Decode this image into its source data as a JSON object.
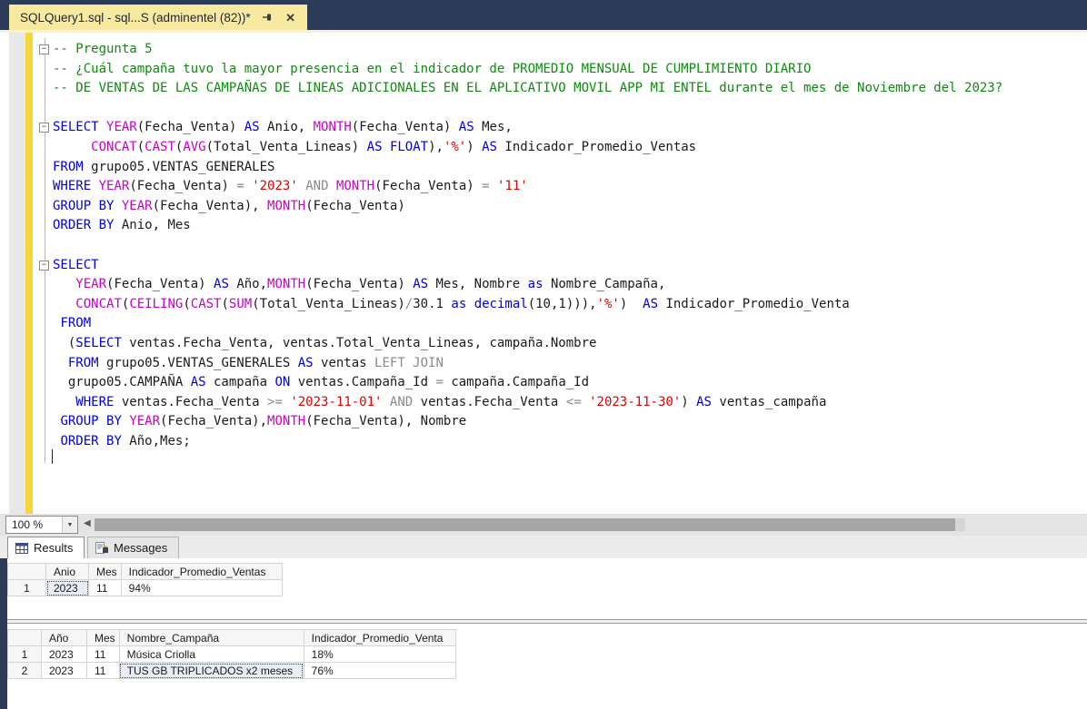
{
  "colors": {
    "window_chrome": "#2b3b58",
    "tab_active_bg": "#f7e9a0",
    "change_tracking_bar": "#f6d73b",
    "syntax_keyword": "#0000e0",
    "syntax_function": "#c800c8",
    "syntax_string": "#e00000",
    "syntax_comment": "#0f8a0f",
    "syntax_operator": "#8a8a8a"
  },
  "tab": {
    "title": "SQLQuery1.sql - sql...S (adminentel (82))*"
  },
  "editor": {
    "lines": [
      {
        "fold": true,
        "tokens": [
          [
            "c",
            "-- Pregunta 5"
          ]
        ]
      },
      {
        "tokens": [
          [
            "c",
            "-- ¿Cuál campaña tuvo la mayor presencia en el indicador de PROMEDIO MENSUAL DE CUMPLIMIENTO DIARIO"
          ]
        ]
      },
      {
        "tokens": [
          [
            "c",
            "-- DE VENTAS DE LAS CAMPAÑAS DE LINEAS ADICIONALES EN EL APLICATIVO MOVIL APP MI ENTEL durante el mes de Noviembre del 2023?"
          ]
        ]
      },
      {
        "tokens": []
      },
      {
        "fold": true,
        "tokens": [
          [
            "k",
            "SELECT "
          ],
          [
            "f",
            "YEAR"
          ],
          [
            "t",
            "(Fecha_Venta) "
          ],
          [
            "k",
            "AS"
          ],
          [
            "t",
            " Anio, "
          ],
          [
            "f",
            "MONTH"
          ],
          [
            "t",
            "(Fecha_Venta) "
          ],
          [
            "k",
            "AS"
          ],
          [
            "t",
            " Mes,"
          ]
        ]
      },
      {
        "tokens": [
          [
            "t",
            "     "
          ],
          [
            "f",
            "CONCAT"
          ],
          [
            "t",
            "("
          ],
          [
            "f",
            "CAST"
          ],
          [
            "t",
            "("
          ],
          [
            "f",
            "AVG"
          ],
          [
            "t",
            "(Total_Venta_Lineas) "
          ],
          [
            "k",
            "AS"
          ],
          [
            "t",
            " "
          ],
          [
            "k",
            "FLOAT"
          ],
          [
            "t",
            "),"
          ],
          [
            "s",
            "'%'"
          ],
          [
            "t",
            ") "
          ],
          [
            "k",
            "AS"
          ],
          [
            "t",
            " Indicador_Promedio_Ventas"
          ]
        ]
      },
      {
        "tokens": [
          [
            "k",
            "FROM"
          ],
          [
            "t",
            " grupo05.VENTAS_GENERALES"
          ]
        ]
      },
      {
        "tokens": [
          [
            "k",
            "WHERE"
          ],
          [
            "t",
            " "
          ],
          [
            "f",
            "YEAR"
          ],
          [
            "t",
            "(Fecha_Venta) "
          ],
          [
            "o",
            "="
          ],
          [
            "t",
            " "
          ],
          [
            "s",
            "'2023'"
          ],
          [
            "t",
            " "
          ],
          [
            "o",
            "AND"
          ],
          [
            "t",
            " "
          ],
          [
            "f",
            "MONTH"
          ],
          [
            "t",
            "(Fecha_Venta) "
          ],
          [
            "o",
            "="
          ],
          [
            "t",
            " "
          ],
          [
            "s",
            "'11'"
          ]
        ]
      },
      {
        "tokens": [
          [
            "k",
            "GROUP BY"
          ],
          [
            "t",
            " "
          ],
          [
            "f",
            "YEAR"
          ],
          [
            "t",
            "(Fecha_Venta), "
          ],
          [
            "f",
            "MONTH"
          ],
          [
            "t",
            "(Fecha_Venta)"
          ]
        ]
      },
      {
        "tokens": [
          [
            "k",
            "ORDER BY"
          ],
          [
            "t",
            " Anio, Mes"
          ]
        ]
      },
      {
        "tokens": []
      },
      {
        "fold": true,
        "tokens": [
          [
            "k",
            "SELECT"
          ]
        ]
      },
      {
        "tokens": [
          [
            "t",
            "   "
          ],
          [
            "f",
            "YEAR"
          ],
          [
            "t",
            "(Fecha_Venta) "
          ],
          [
            "k",
            "AS"
          ],
          [
            "t",
            " Año,"
          ],
          [
            "f",
            "MONTH"
          ],
          [
            "t",
            "(Fecha_Venta) "
          ],
          [
            "k",
            "AS"
          ],
          [
            "t",
            " Mes, Nombre "
          ],
          [
            "k",
            "as"
          ],
          [
            "t",
            " Nombre_Campaña,"
          ]
        ]
      },
      {
        "tokens": [
          [
            "t",
            "   "
          ],
          [
            "f",
            "CONCAT"
          ],
          [
            "t",
            "("
          ],
          [
            "f",
            "CEILING"
          ],
          [
            "t",
            "("
          ],
          [
            "f",
            "CAST"
          ],
          [
            "t",
            "("
          ],
          [
            "f",
            "SUM"
          ],
          [
            "t",
            "(Total_Venta_Lineas)"
          ],
          [
            "o",
            "/"
          ],
          [
            "t",
            "30.1 "
          ],
          [
            "k",
            "as"
          ],
          [
            "t",
            " "
          ],
          [
            "k",
            "decimal"
          ],
          [
            "t",
            "(10,1))),"
          ],
          [
            "s",
            "'%'"
          ],
          [
            "t",
            ")  "
          ],
          [
            "k",
            "AS"
          ],
          [
            "t",
            " Indicador_Promedio_Venta"
          ]
        ]
      },
      {
        "tokens": [
          [
            "t",
            " "
          ],
          [
            "k",
            "FROM"
          ]
        ]
      },
      {
        "tokens": [
          [
            "t",
            "  ("
          ],
          [
            "k",
            "SELECT"
          ],
          [
            "t",
            " ventas.Fecha_Venta, ventas.Total_Venta_Lineas, campaña.Nombre"
          ]
        ]
      },
      {
        "tokens": [
          [
            "t",
            "  "
          ],
          [
            "k",
            "FROM"
          ],
          [
            "t",
            " grupo05.VENTAS_GENERALES "
          ],
          [
            "k",
            "AS"
          ],
          [
            "t",
            " ventas "
          ],
          [
            "o",
            "LEFT JOIN"
          ]
        ]
      },
      {
        "tokens": [
          [
            "t",
            "  grupo05.CAMPAÑA "
          ],
          [
            "k",
            "AS"
          ],
          [
            "t",
            " campaña "
          ],
          [
            "k",
            "ON"
          ],
          [
            "t",
            " ventas.Campaña_Id "
          ],
          [
            "o",
            "="
          ],
          [
            "t",
            " campaña.Campaña_Id"
          ]
        ]
      },
      {
        "tokens": [
          [
            "t",
            "   "
          ],
          [
            "k",
            "WHERE"
          ],
          [
            "t",
            " ventas.Fecha_Venta "
          ],
          [
            "o",
            ">="
          ],
          [
            "t",
            " "
          ],
          [
            "s",
            "'2023-11-01'"
          ],
          [
            "t",
            " "
          ],
          [
            "o",
            "AND"
          ],
          [
            "t",
            " ventas.Fecha_Venta "
          ],
          [
            "o",
            "<="
          ],
          [
            "t",
            " "
          ],
          [
            "s",
            "'2023-11-30'"
          ],
          [
            "t",
            ") "
          ],
          [
            "k",
            "AS"
          ],
          [
            "t",
            " ventas_campaña"
          ]
        ]
      },
      {
        "tokens": [
          [
            "t",
            " "
          ],
          [
            "k",
            "GROUP BY"
          ],
          [
            "t",
            " "
          ],
          [
            "f",
            "YEAR"
          ],
          [
            "t",
            "(Fecha_Venta),"
          ],
          [
            "f",
            "MONTH"
          ],
          [
            "t",
            "(Fecha_Venta), Nombre"
          ]
        ]
      },
      {
        "tokens": [
          [
            "t",
            " "
          ],
          [
            "k",
            "ORDER BY"
          ],
          [
            "t",
            " Año,Mes;"
          ]
        ]
      }
    ]
  },
  "statusrow": {
    "zoom_value": "100 %"
  },
  "results_tabs": {
    "results_label": "Results",
    "messages_label": "Messages"
  },
  "grid1": {
    "headers": [
      "Anio",
      "Mes",
      "Indicador_Promedio_Ventas"
    ],
    "rows": [
      [
        "1",
        "2023",
        "11",
        "94%"
      ]
    ],
    "selected_cell": {
      "row": 0,
      "col": 1
    }
  },
  "grid2": {
    "headers": [
      "Año",
      "Mes",
      "Nombre_Campaña",
      "Indicador_Promedio_Venta"
    ],
    "rows": [
      [
        "1",
        "2023",
        "11",
        "Música Criolla",
        "18%"
      ],
      [
        "2",
        "2023",
        "11",
        "TUS GB TRIPLICADOS x2 meses",
        "76%"
      ]
    ],
    "selected_cell": {
      "row": 1,
      "col": 3
    }
  }
}
